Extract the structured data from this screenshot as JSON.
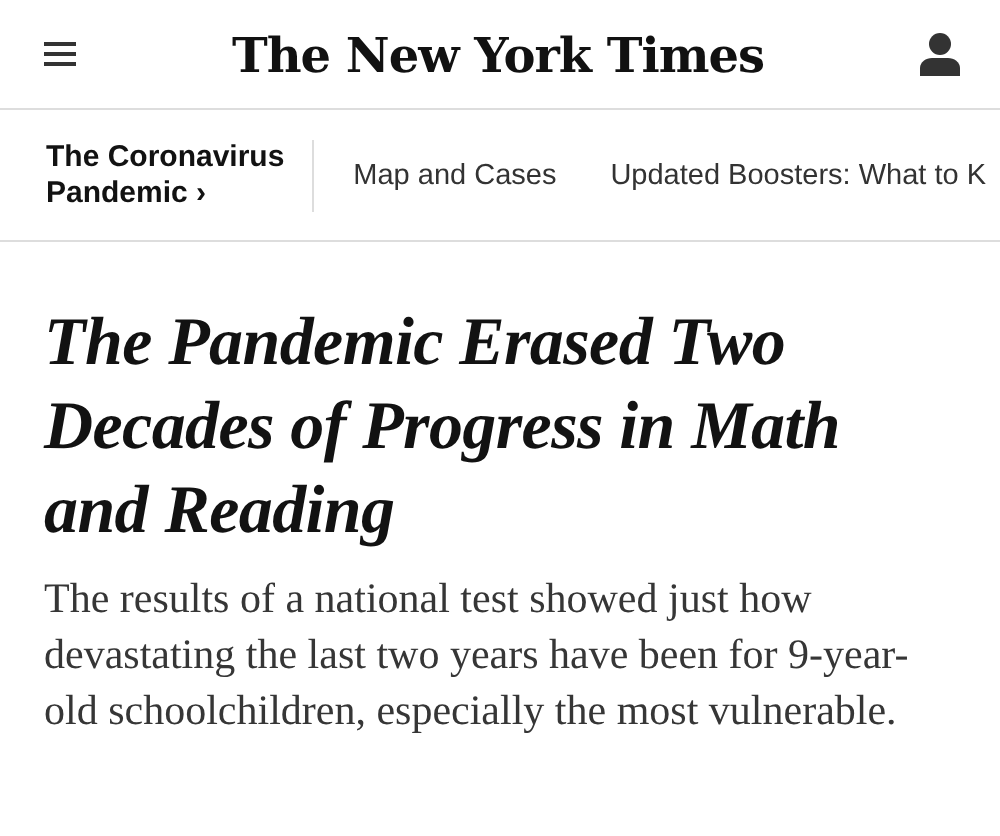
{
  "masthead": {
    "title": "The New York Times"
  },
  "section_nav": {
    "section": "The Coronavirus Pandemic ›",
    "links": [
      "Map and Cases",
      "Updated Boosters: What to K"
    ]
  },
  "article": {
    "headline": "The Pandemic Erased Two Decades of Progress in Math and Reading",
    "summary": "The results of a national test showed just how devastating the last two years have been for 9-year-old schoolchildren, especially the most vulnerable."
  }
}
